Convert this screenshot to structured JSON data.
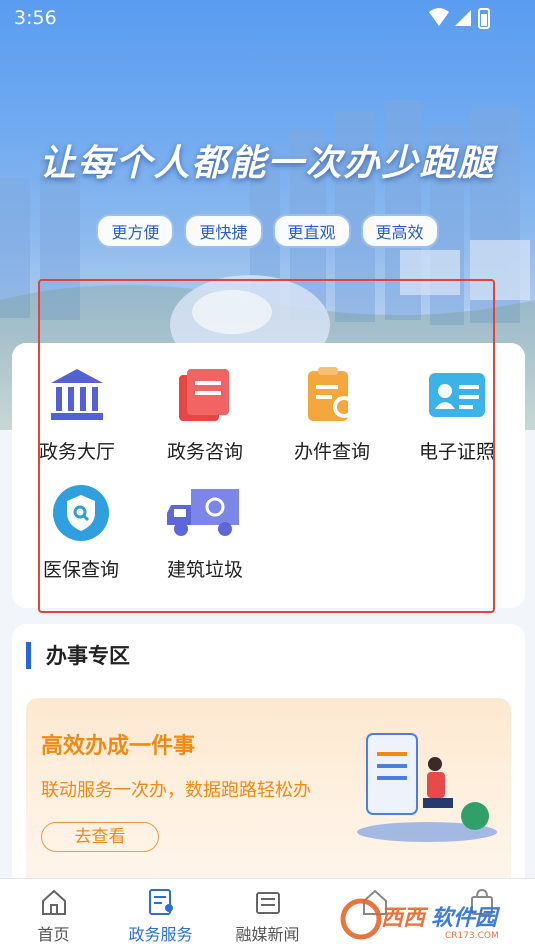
{
  "status": {
    "time": "3:56"
  },
  "banner": {
    "slogan": "让每个人都能一次办少跑腿",
    "tags": [
      "更方便",
      "更快捷",
      "更直观",
      "更高效"
    ]
  },
  "services": [
    {
      "label": "政务大厅",
      "icon": "government-hall-icon"
    },
    {
      "label": "政务咨询",
      "icon": "consultation-icon"
    },
    {
      "label": "办件查询",
      "icon": "case-query-icon"
    },
    {
      "label": "电子证照",
      "icon": "e-license-icon"
    },
    {
      "label": "医保查询",
      "icon": "medical-insurance-icon"
    },
    {
      "label": "建筑垃圾",
      "icon": "garbage-truck-icon"
    }
  ],
  "zone": {
    "title": "办事专区",
    "promo": {
      "title": "高效办成一件事",
      "subtitle": "联动服务一次办，数据跑路轻松办",
      "button": "去查看"
    }
  },
  "tabbar": {
    "tabs": [
      {
        "label": "首页",
        "icon": "home-icon",
        "active": false
      },
      {
        "label": "政务服务",
        "icon": "gov-service-icon",
        "active": true
      },
      {
        "label": "融媒新闻",
        "icon": "news-icon",
        "active": false
      },
      {
        "label": "",
        "icon": "building-icon",
        "active": false
      },
      {
        "label": "",
        "icon": "bag-icon",
        "active": false
      }
    ]
  },
  "watermark": {
    "text": "西西软件园",
    "sub": "CR173.COM"
  },
  "colors": {
    "accent": "#2a6fd8",
    "promo": "#f08a14",
    "highlight": "#e0443a"
  }
}
